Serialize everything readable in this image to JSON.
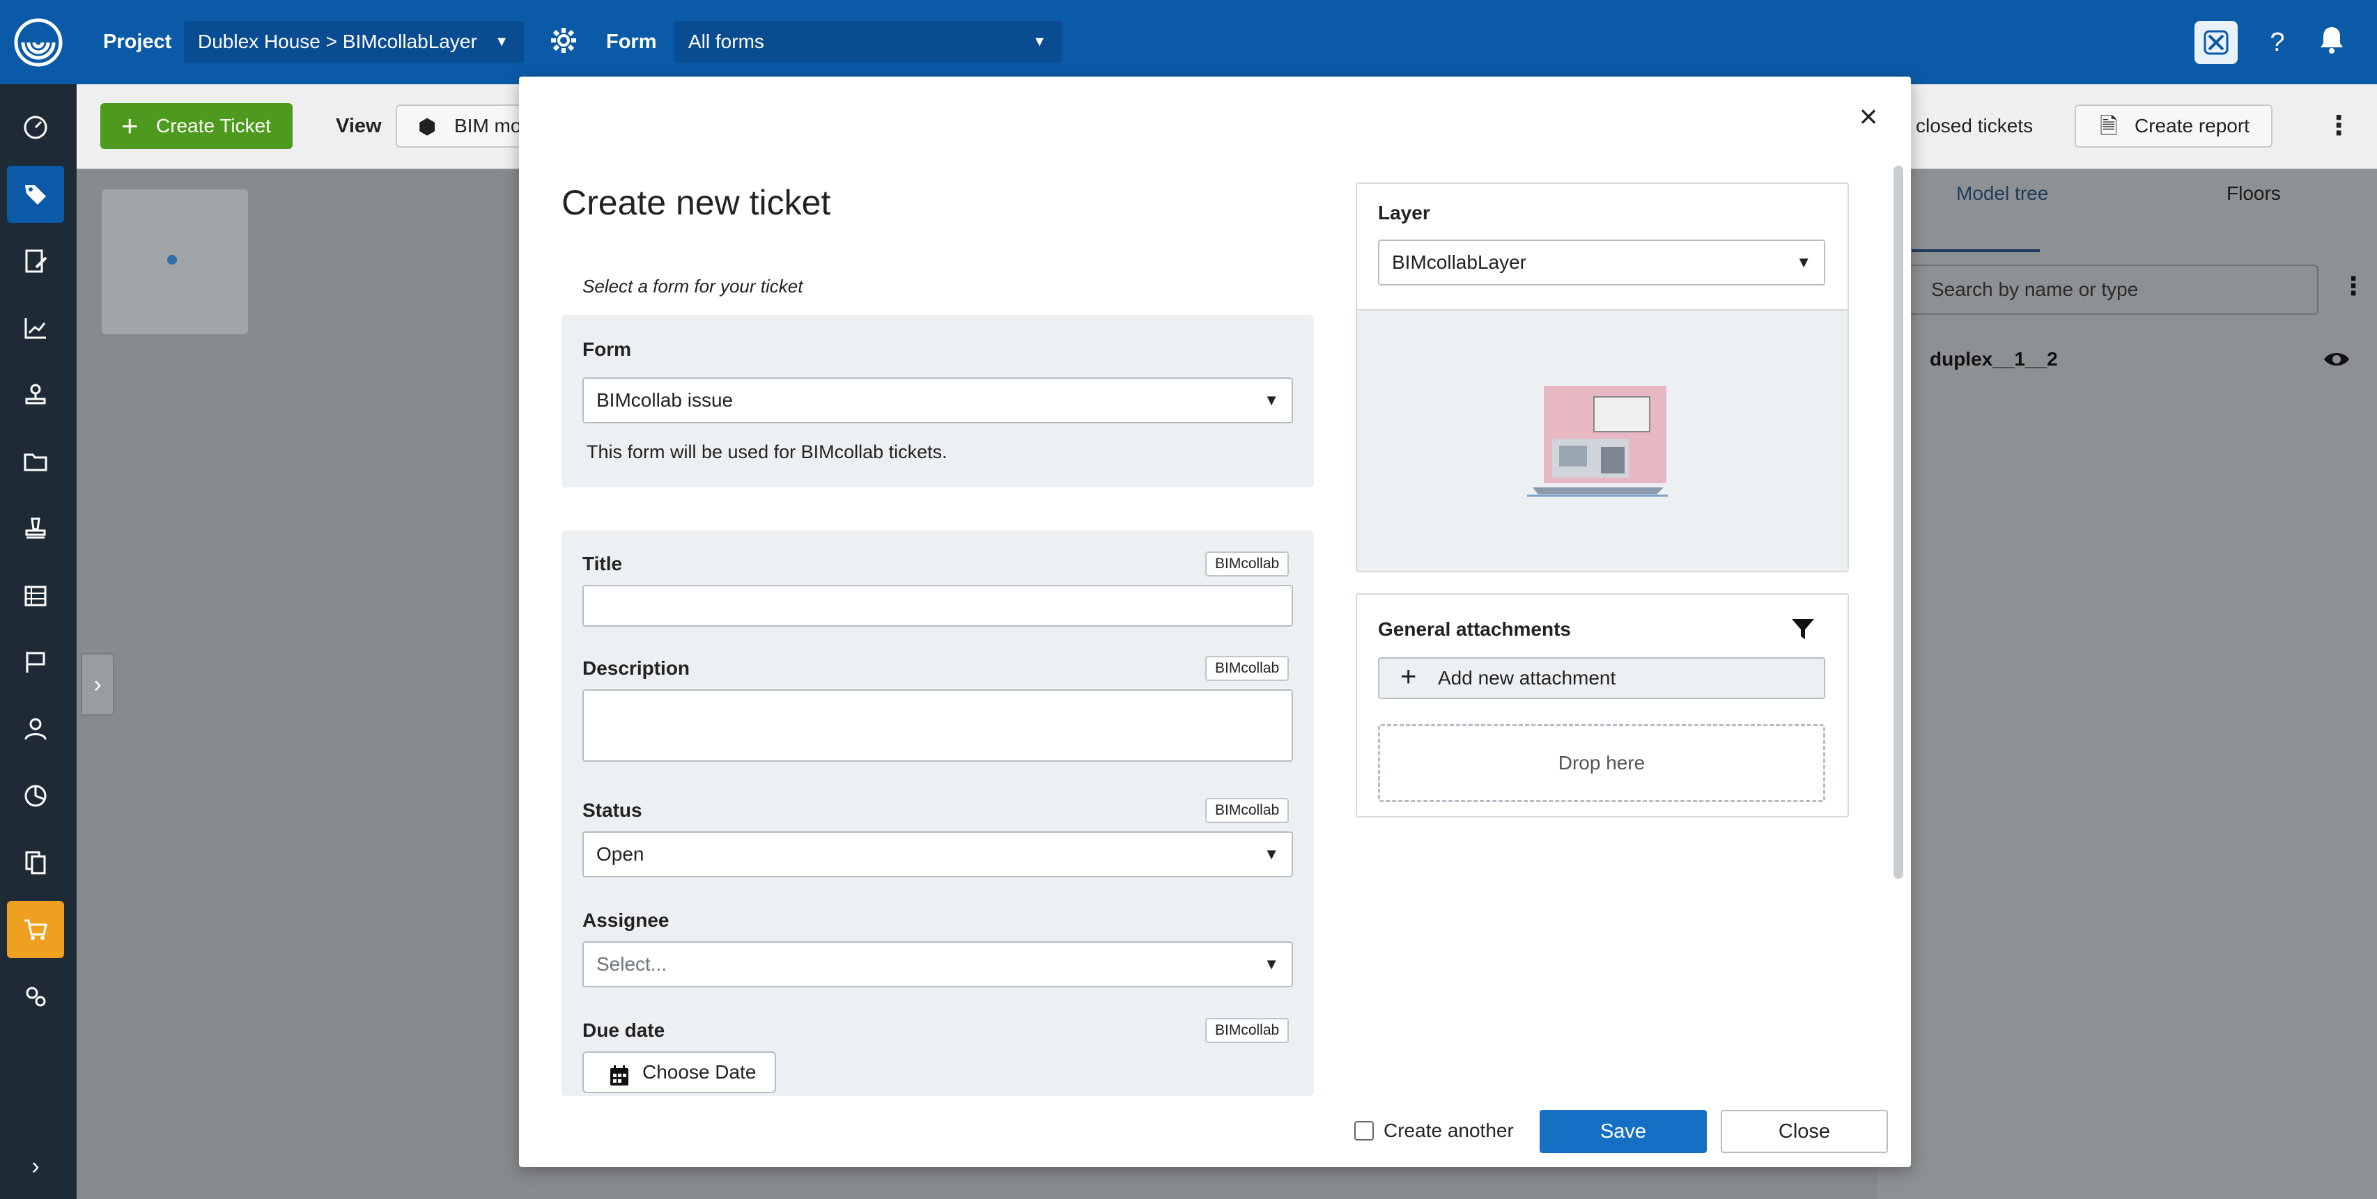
{
  "topbar": {
    "project_label": "Project",
    "project_value": "Dublex House > BIMcollabLayer",
    "form_label": "Form",
    "form_value": "All forms"
  },
  "toolbar": {
    "create_ticket": "Create Ticket",
    "view_label": "View",
    "bim_model": "BIM mo",
    "closed_tickets": "closed tickets",
    "create_report": "Create report"
  },
  "right_panel": {
    "tabs": [
      "Model tree",
      "Floors"
    ],
    "search_placeholder": "Search by name or type",
    "tree_item": "duplex__1__2"
  },
  "modal": {
    "title": "Create new ticket",
    "subtitle": "Select a form for your ticket",
    "form_label": "Form",
    "form_value": "BIMcollab issue",
    "form_help": "This form will be used for BIMcollab tickets.",
    "fields": {
      "title_label": "Title",
      "title_tag": "BIMcollab",
      "description_label": "Description",
      "description_tag": "BIMcollab",
      "status_label": "Status",
      "status_tag": "BIMcollab",
      "status_value": "Open",
      "assignee_label": "Assignee",
      "assignee_placeholder": "Select...",
      "due_date_label": "Due date",
      "due_date_tag": "BIMcollab",
      "choose_date": "Choose Date"
    },
    "layer": {
      "label": "Layer",
      "value": "BIMcollabLayer"
    },
    "attachments": {
      "label": "General attachments",
      "add_button": "Add new attachment",
      "drop_here": "Drop here"
    },
    "footer": {
      "create_another": "Create another",
      "save": "Save",
      "close": "Close"
    }
  },
  "colors": {
    "topbar": "#0b5aa8",
    "sidebar": "#1e2a36",
    "primary_button": "#1570c4",
    "create_ticket_button": "#4e9a1e",
    "cart_highlight": "#f0a020"
  }
}
